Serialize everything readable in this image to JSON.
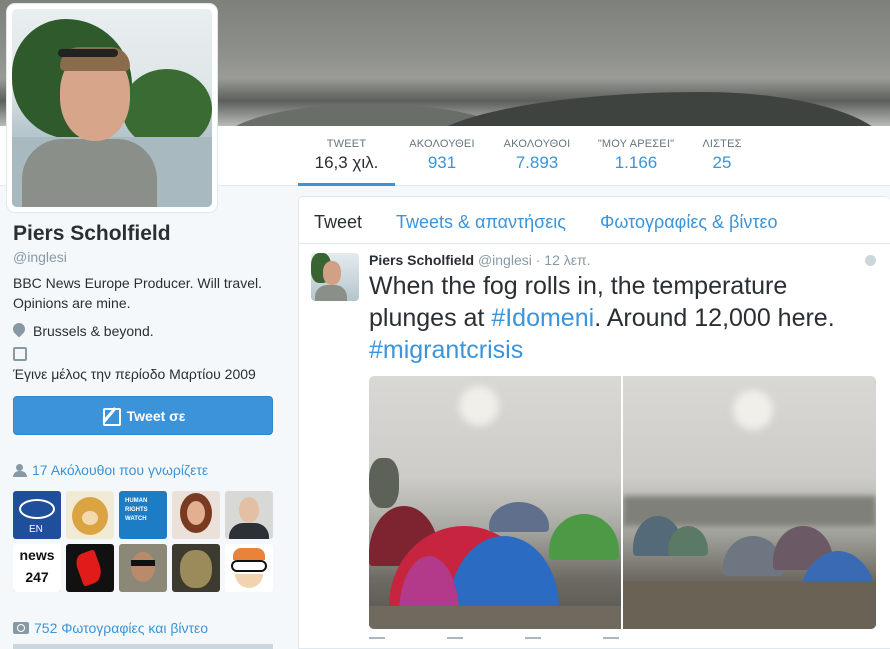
{
  "stats": [
    {
      "label": "TWEET",
      "value": "16,3 χιλ."
    },
    {
      "label": "ΑΚΟΛΟΥΘΕΙ",
      "value": "931"
    },
    {
      "label": "ΑΚΟΛΟΥΘΟΙ",
      "value": "7.893"
    },
    {
      "label": "\"ΜΟΥ ΑΡΕΣΕΙ\"",
      "value": "1.166"
    },
    {
      "label": "ΛΙΣΤΕΣ",
      "value": "25"
    }
  ],
  "profile": {
    "name": "Piers Scholfield",
    "handle": "@inglesi",
    "bio": "BBC News Europe Producer. Will travel. Opinions are mine.",
    "location": "Brussels & beyond.",
    "joined": "Έγινε μέλος την περίοδο Μαρτίου 2009",
    "tweet_to_label": "Tweet σε",
    "followers_you_know": "17 Ακόλουθοι που γνωρίζετε",
    "media_link": "752 Φωτογραφίες και βίντεο"
  },
  "thumbs": [
    {
      "name": "eu-parliament",
      "caption": "EN",
      "bg": "#1f4e9b"
    },
    {
      "name": "cartoon-lion",
      "caption": "",
      "bg": "#e8c25a"
    },
    {
      "name": "human-rights-watch",
      "caption": "HUMAN RIGHTS WATCH",
      "bg": "#1c7cc6"
    },
    {
      "name": "woman-portrait",
      "caption": "",
      "bg": "#c9866a"
    },
    {
      "name": "man-portrait",
      "caption": "",
      "bg": "#5c5d5e"
    },
    {
      "name": "news247",
      "caption": "news 247",
      "bg": "#ffffff"
    },
    {
      "name": "red-logo",
      "caption": "",
      "bg": "#111111"
    },
    {
      "name": "man-sunglasses",
      "caption": "",
      "bg": "#7d7a70"
    },
    {
      "name": "masked-figure",
      "caption": "",
      "bg": "#3d3a30"
    },
    {
      "name": "cartoon-dexter",
      "caption": "",
      "bg": "#ffffff"
    }
  ],
  "tabs": [
    "Tweet",
    "Tweets & απαντήσεις",
    "Φωτογραφίες & βίντεο"
  ],
  "tweet": {
    "name": "Piers Scholfield",
    "handle": "@inglesi",
    "time": "· 12 λεπ.",
    "text_before": "When the fog rolls in, the temperature plunges at ",
    "hashtag1": "#Idomeni",
    "text_middle": ". Around 12,000 here. ",
    "hashtag2": "#migrantcrisis"
  },
  "colors": {
    "accent": "#3b94d9",
    "text": "#292f33",
    "muted": "#8899a6"
  }
}
